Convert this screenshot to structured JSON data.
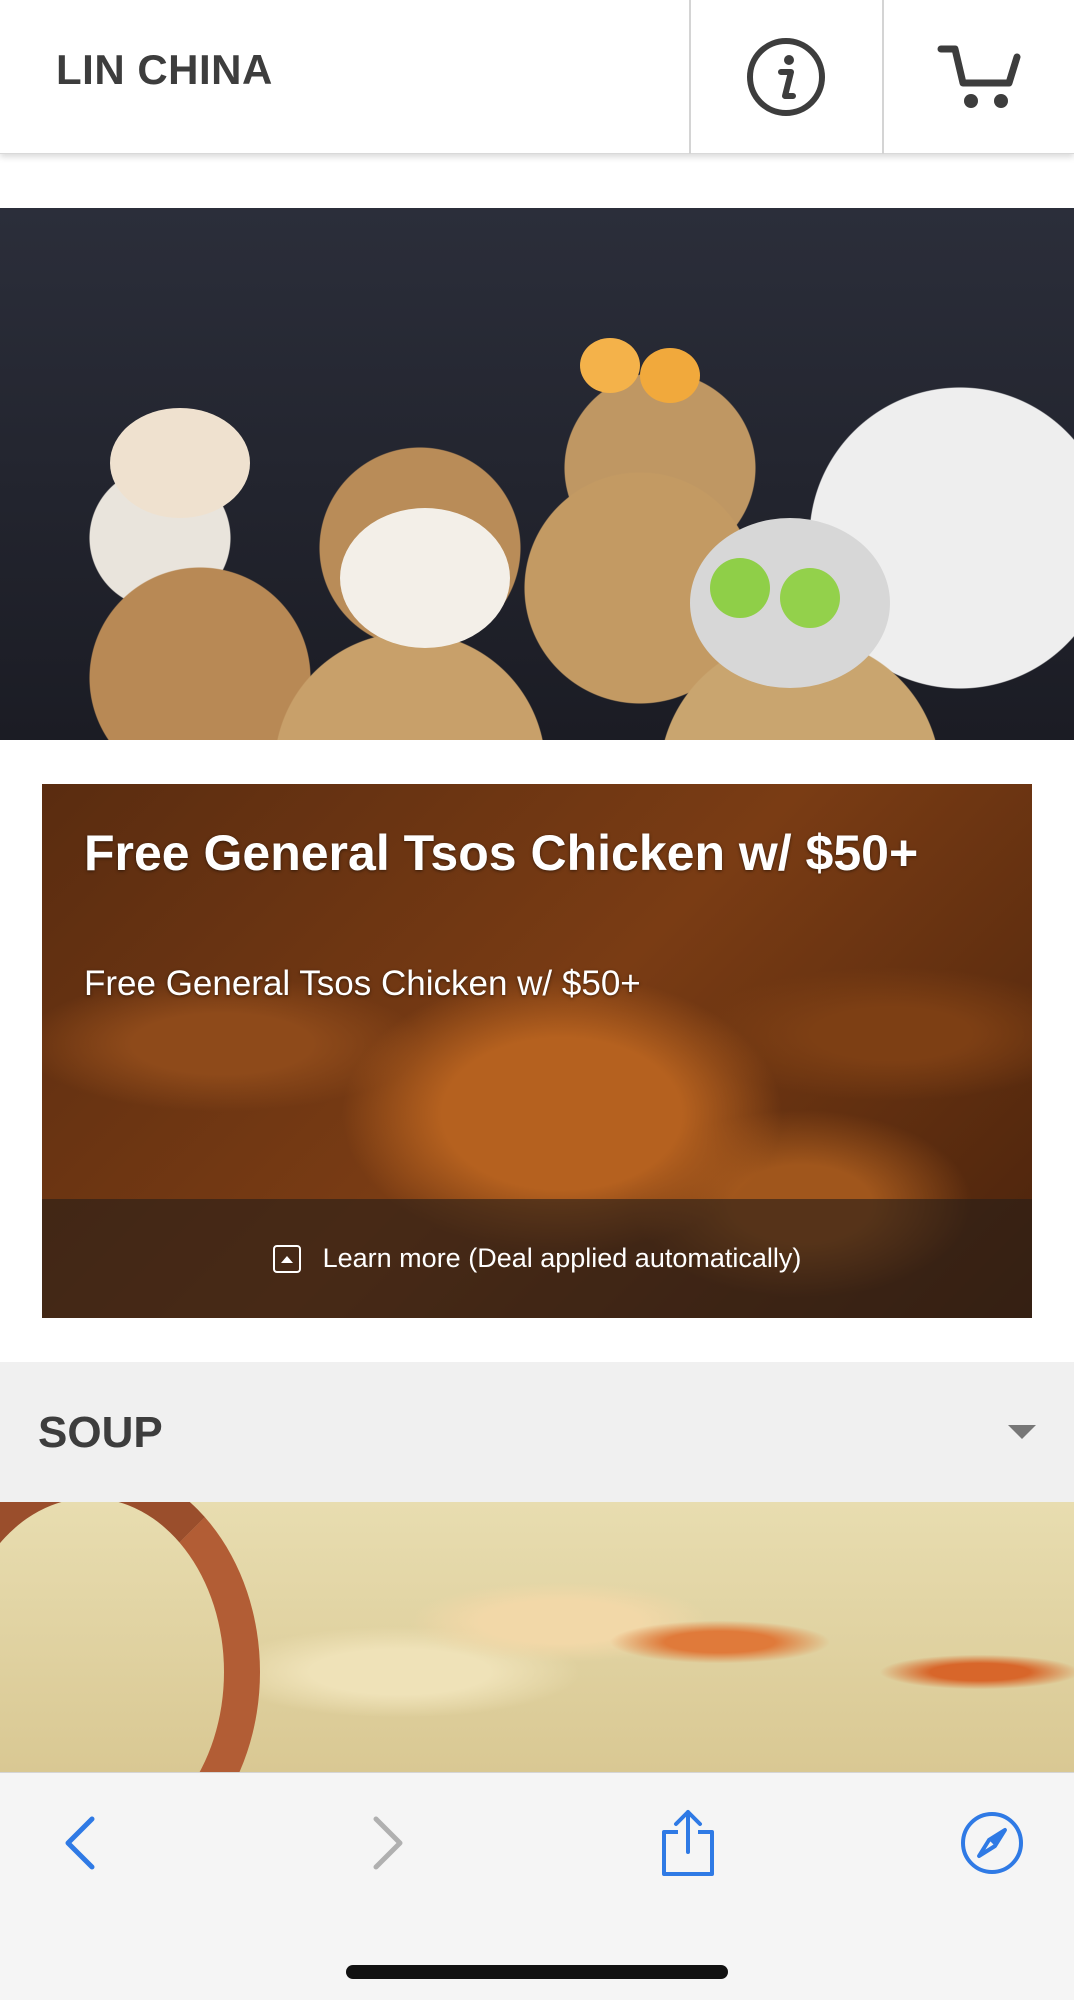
{
  "header": {
    "brand": "LIN CHINA",
    "info_icon": "info-icon",
    "cart_icon": "cart-icon"
  },
  "deal": {
    "title": "Free General Tsos Chicken w/ $50+",
    "subtitle": "Free General Tsos Chicken w/ $50+",
    "learn_more": "Learn more (Deal applied automatically)"
  },
  "menu": {
    "section_title": "SOUP"
  },
  "toolbar": {
    "icons": [
      "back-icon",
      "forward-icon",
      "share-icon",
      "compass-icon"
    ]
  },
  "colors": {
    "header_text": "#3d3d3d",
    "toolbar_blue": "#2f7ae5",
    "toolbar_disabled": "#b0b0b0",
    "section_bg": "#f0f0f0"
  }
}
